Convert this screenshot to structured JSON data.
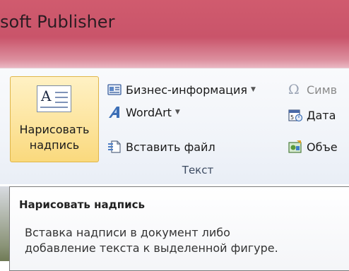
{
  "window": {
    "title": "soft Publisher"
  },
  "ribbon": {
    "draw_textbox": {
      "label_line1": "Нарисовать",
      "label_line2": "надпись",
      "icon": "text-box-icon",
      "icon_letter": "A"
    },
    "items": [
      {
        "label": "Бизнес-информация",
        "icon": "business-card-icon",
        "dropdown": "▼"
      },
      {
        "label": "WordArt",
        "icon": "wordart-icon",
        "dropdown": "▼"
      },
      {
        "label": "Вставить файл",
        "icon": "insert-file-icon"
      }
    ],
    "right_items": [
      {
        "label": "Симв",
        "icon": "omega-icon",
        "glyph": "Ω"
      },
      {
        "label": "Дата",
        "icon": "calendar-icon"
      },
      {
        "label": "Объе",
        "icon": "object-icon"
      }
    ],
    "group_label": "Текст"
  },
  "tooltip": {
    "title": "Нарисовать надпись",
    "body_line1": "Вставка надписи в документ либо",
    "body_line2": "добавление текста к выделенной фигуре."
  }
}
